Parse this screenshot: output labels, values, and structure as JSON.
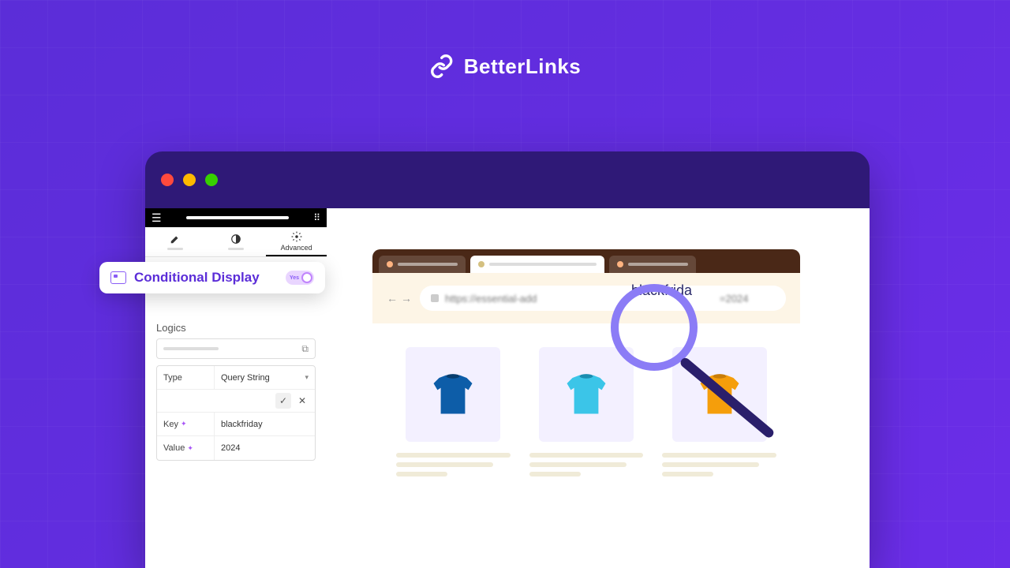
{
  "brand": {
    "name": "BetterLinks"
  },
  "editor": {
    "tabs": {
      "advanced": "Advanced"
    },
    "conditional": {
      "title": "Conditional Display",
      "toggle_label": "Yes"
    },
    "logics": {
      "title": "Logics",
      "type_label": "Type",
      "type_value": "Query String",
      "key_label": "Key",
      "key_value": "blackfriday",
      "value_label": "Value",
      "value_value": "2024"
    }
  },
  "browser": {
    "url_blur": "https://essential-add",
    "url_focus": "blackfrida",
    "url_after": "=2024"
  },
  "colors": {
    "tshirt1": "#0d5da8",
    "tshirt2": "#3bc5e8",
    "tshirt3": "#f59e0b"
  }
}
